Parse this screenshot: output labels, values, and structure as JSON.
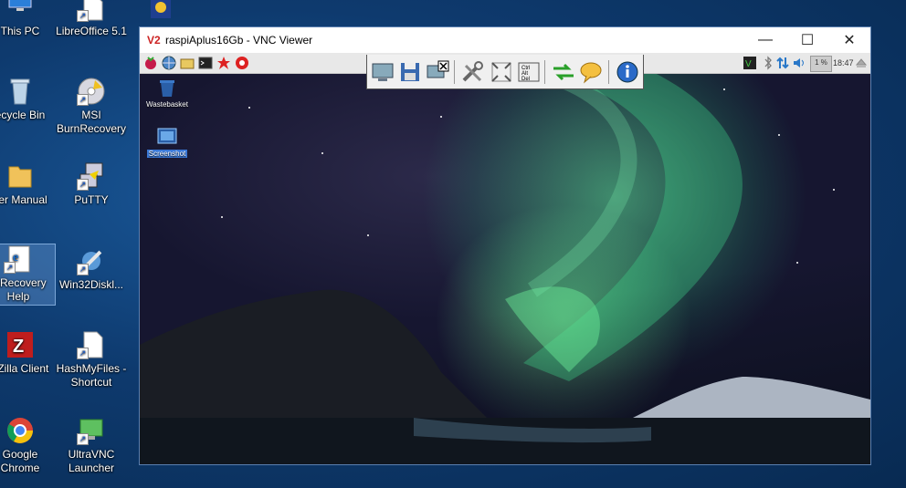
{
  "desktop": {
    "left_column": [
      {
        "label": "This PC",
        "icon": "this-pc-icon"
      },
      {
        "label": "ecycle Bin",
        "icon": "recycle-bin-icon"
      },
      {
        "label": "ser Manual",
        "icon": "folder-icon"
      },
      {
        "label": "rnRecovery Help",
        "icon": "html-document-icon"
      },
      {
        "label": "eZilla Client",
        "icon": "filezilla-icon"
      },
      {
        "label": "Google Chrome",
        "icon": "chrome-icon"
      }
    ],
    "right_column": [
      {
        "label": "LibreOffice 5.1",
        "icon": "libreoffice-icon"
      },
      {
        "label": "MSI BurnRecovery",
        "icon": "disc-icon"
      },
      {
        "label": "PuTTY",
        "icon": "putty-icon"
      },
      {
        "label": "Win32Diskl...",
        "icon": "disk-imager-icon"
      },
      {
        "label": "HashMyFiles - Shortcut",
        "icon": "document-icon"
      },
      {
        "label": "UltraVNC Launcher",
        "icon": "ultravnc-icon"
      }
    ]
  },
  "window": {
    "title": "raspiAplus16Gb - VNC Viewer",
    "minimize": "—",
    "maximize": "☐",
    "close": "✕"
  },
  "remote": {
    "desktop_icons": [
      {
        "label": "Wastebasket",
        "icon": "wastebasket-icon"
      },
      {
        "label": "Screenshot",
        "icon": "screenshot-icon"
      }
    ],
    "clock": "18:47",
    "cpu_label": "1 %"
  },
  "colors": {
    "aurora": "#4fe08e",
    "selection": "#3a78d6"
  }
}
